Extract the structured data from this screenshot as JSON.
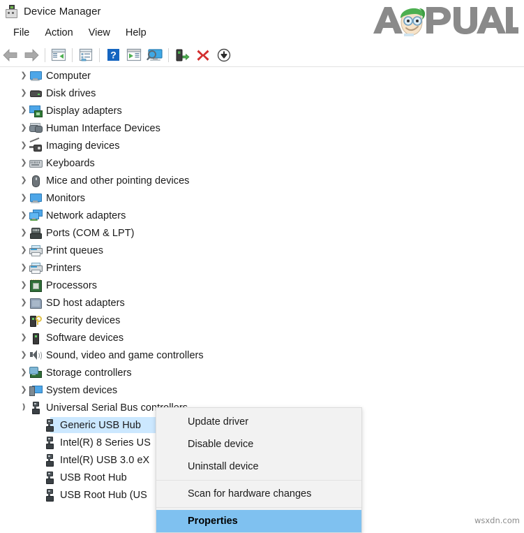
{
  "window": {
    "title": "Device Manager",
    "icon": "device-manager-icon"
  },
  "menubar": {
    "items": [
      {
        "label": "File"
      },
      {
        "label": "Action"
      },
      {
        "label": "View"
      },
      {
        "label": "Help"
      }
    ]
  },
  "toolbar": {
    "buttons": [
      {
        "name": "back-button",
        "icon": "back-arrow-icon",
        "tooltip": "Back"
      },
      {
        "name": "forward-button",
        "icon": "forward-arrow-icon",
        "tooltip": "Forward"
      },
      {
        "name": "separator",
        "icon": "separator"
      },
      {
        "name": "up-one-level-button",
        "icon": "window-left-pane-icon",
        "tooltip": "Up one level"
      },
      {
        "name": "separator",
        "icon": "separator"
      },
      {
        "name": "properties-button",
        "icon": "properties-window-icon",
        "tooltip": "Properties"
      },
      {
        "name": "separator",
        "icon": "separator"
      },
      {
        "name": "help-button",
        "icon": "question-mark-icon",
        "tooltip": "Help"
      },
      {
        "name": "show-hide-console-tree-button",
        "icon": "window-play-icon",
        "tooltip": "Show/Hide console tree"
      },
      {
        "name": "scan-hardware-changes-button",
        "icon": "monitor-magnifier-icon",
        "tooltip": "Scan for hardware changes"
      },
      {
        "name": "separator",
        "icon": "separator"
      },
      {
        "name": "update-driver-button",
        "icon": "device-update-icon",
        "tooltip": "Update driver"
      },
      {
        "name": "uninstall-device-button",
        "icon": "red-x-icon",
        "tooltip": "Uninstall device"
      },
      {
        "name": "disable-device-button",
        "icon": "down-arrow-circle-icon",
        "tooltip": "Disable device"
      }
    ]
  },
  "tree": {
    "nodes": [
      {
        "label": "Computer",
        "icon": "monitor-icon",
        "level": 1,
        "expanded": false,
        "chevron": "collapsed",
        "selected": false
      },
      {
        "label": "Disk drives",
        "icon": "disk-drive-icon",
        "level": 1,
        "expanded": false,
        "chevron": "collapsed",
        "selected": false
      },
      {
        "label": "Display adapters",
        "icon": "display-adapter-icon",
        "level": 1,
        "expanded": false,
        "chevron": "collapsed",
        "selected": false
      },
      {
        "label": "Human Interface Devices",
        "icon": "gamepad-icon",
        "level": 1,
        "expanded": false,
        "chevron": "collapsed",
        "selected": false
      },
      {
        "label": "Imaging devices",
        "icon": "imaging-device-icon",
        "level": 1,
        "expanded": false,
        "chevron": "collapsed",
        "selected": false
      },
      {
        "label": "Keyboards",
        "icon": "keyboard-icon",
        "level": 1,
        "expanded": false,
        "chevron": "collapsed",
        "selected": false
      },
      {
        "label": "Mice and other pointing devices",
        "icon": "mouse-icon",
        "level": 1,
        "expanded": false,
        "chevron": "collapsed",
        "selected": false
      },
      {
        "label": "Monitors",
        "icon": "monitor-icon",
        "level": 1,
        "expanded": false,
        "chevron": "collapsed",
        "selected": false
      },
      {
        "label": "Network adapters",
        "icon": "network-adapter-icon",
        "level": 1,
        "expanded": false,
        "chevron": "collapsed",
        "selected": false
      },
      {
        "label": "Ports (COM & LPT)",
        "icon": "port-connector-icon",
        "level": 1,
        "expanded": false,
        "chevron": "collapsed",
        "selected": false
      },
      {
        "label": "Print queues",
        "icon": "printer-icon",
        "level": 1,
        "expanded": false,
        "chevron": "collapsed",
        "selected": false
      },
      {
        "label": "Printers",
        "icon": "printer-icon",
        "level": 1,
        "expanded": false,
        "chevron": "collapsed",
        "selected": false
      },
      {
        "label": "Processors",
        "icon": "cpu-icon",
        "level": 1,
        "expanded": false,
        "chevron": "collapsed",
        "selected": false
      },
      {
        "label": "SD host adapters",
        "icon": "sd-card-icon",
        "level": 1,
        "expanded": false,
        "chevron": "collapsed",
        "selected": false
      },
      {
        "label": "Security devices",
        "icon": "security-device-icon",
        "level": 1,
        "expanded": false,
        "chevron": "collapsed",
        "selected": false
      },
      {
        "label": "Software devices",
        "icon": "software-device-icon",
        "level": 1,
        "expanded": false,
        "chevron": "collapsed",
        "selected": false
      },
      {
        "label": "Sound, video and game controllers",
        "icon": "speaker-icon",
        "level": 1,
        "expanded": false,
        "chevron": "collapsed",
        "selected": false
      },
      {
        "label": "Storage controllers",
        "icon": "storage-controller-icon",
        "level": 1,
        "expanded": false,
        "chevron": "collapsed",
        "selected": false
      },
      {
        "label": "System devices",
        "icon": "system-device-icon",
        "level": 1,
        "expanded": false,
        "chevron": "collapsed",
        "selected": false
      },
      {
        "label": "Universal Serial Bus controllers",
        "icon": "usb-icon",
        "level": 1,
        "expanded": true,
        "chevron": "expanded",
        "selected": false
      },
      {
        "label": "Generic USB Hub",
        "icon": "usb-icon",
        "level": 2,
        "expanded": false,
        "chevron": "none",
        "selected": true
      },
      {
        "label": "Intel(R) 8 Series US",
        "icon": "usb-icon",
        "level": 2,
        "expanded": false,
        "chevron": "none",
        "selected": false
      },
      {
        "label": "Intel(R) USB 3.0 eX",
        "icon": "usb-icon",
        "level": 2,
        "expanded": false,
        "chevron": "none",
        "selected": false
      },
      {
        "label": "USB Root Hub",
        "icon": "usb-icon",
        "level": 2,
        "expanded": false,
        "chevron": "none",
        "selected": false
      },
      {
        "label": "USB Root Hub (US",
        "icon": "usb-icon",
        "level": 2,
        "expanded": false,
        "chevron": "none",
        "selected": false
      }
    ]
  },
  "context_menu": {
    "items": [
      {
        "label": "Update driver",
        "type": "item",
        "highlighted": false
      },
      {
        "label": "Disable device",
        "type": "item",
        "highlighted": false
      },
      {
        "label": "Uninstall device",
        "type": "item",
        "highlighted": false
      },
      {
        "label": "",
        "type": "separator",
        "highlighted": false
      },
      {
        "label": "Scan for hardware changes",
        "type": "item",
        "highlighted": false
      },
      {
        "label": "",
        "type": "separator",
        "highlighted": false
      },
      {
        "label": "Properties",
        "type": "item",
        "highlighted": true
      }
    ]
  },
  "watermarks": {
    "logo_text_left": "A",
    "logo_text_right": "PUALS",
    "site": "wsxdn.com"
  },
  "colors": {
    "selection_blue": "#cce8ff",
    "menu_highlight_blue": "#7fc1f0",
    "menu_background": "#f2f2f2",
    "logo_gray": "#808080",
    "logo_green": "#5cb85c"
  }
}
